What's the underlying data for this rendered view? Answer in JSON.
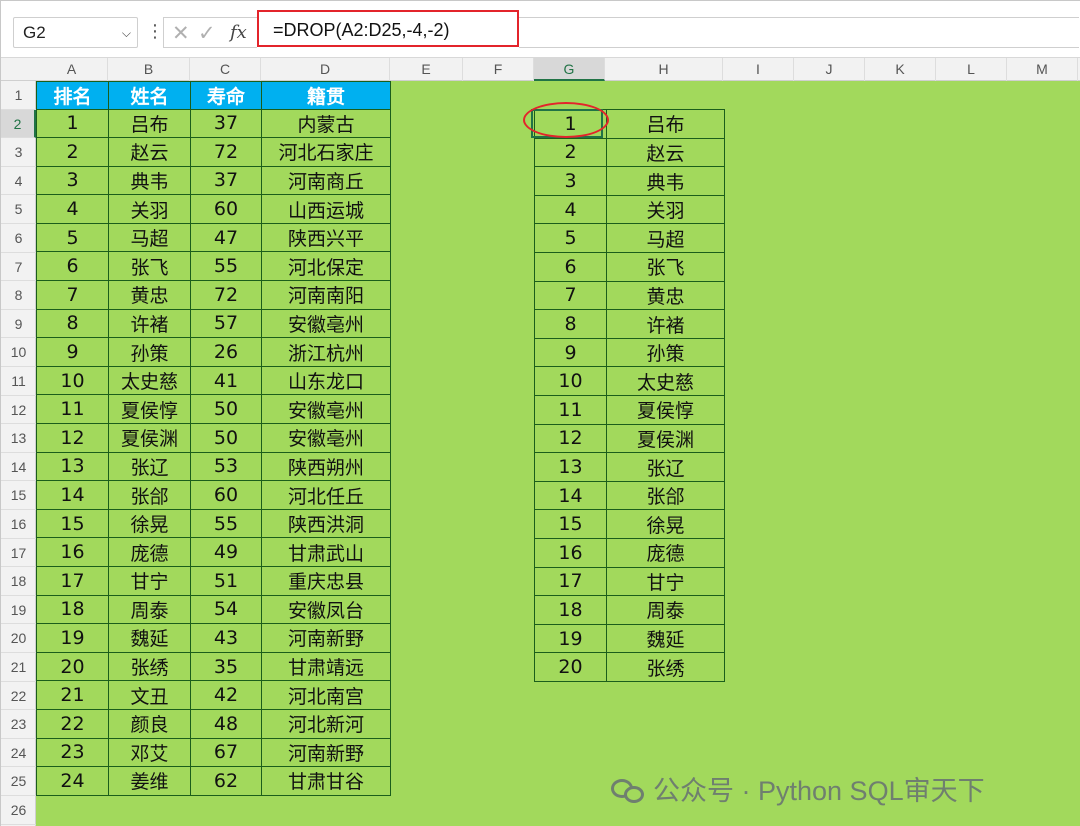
{
  "name_box": "G2",
  "formula": "=DROP(A2:D25,-4,-2)",
  "fx_label": "fx",
  "columns": [
    "A",
    "B",
    "C",
    "D",
    "E",
    "F",
    "G",
    "H",
    "I",
    "J",
    "K",
    "L",
    "M"
  ],
  "rows": [
    "1",
    "2",
    "3",
    "4",
    "5",
    "6",
    "7",
    "8",
    "9",
    "10",
    "11",
    "12",
    "13",
    "14",
    "15",
    "16",
    "17",
    "18",
    "19",
    "20",
    "21",
    "22",
    "23",
    "24",
    "25",
    "26"
  ],
  "source_table": {
    "headers": [
      "排名",
      "姓名",
      "寿命",
      "籍贯"
    ],
    "rows": [
      [
        "1",
        "吕布",
        "37",
        "内蒙古"
      ],
      [
        "2",
        "赵云",
        "72",
        "河北石家庄"
      ],
      [
        "3",
        "典韦",
        "37",
        "河南商丘"
      ],
      [
        "4",
        "关羽",
        "60",
        "山西运城"
      ],
      [
        "5",
        "马超",
        "47",
        "陕西兴平"
      ],
      [
        "6",
        "张飞",
        "55",
        "河北保定"
      ],
      [
        "7",
        "黄忠",
        "72",
        "河南南阳"
      ],
      [
        "8",
        "许褚",
        "57",
        "安徽亳州"
      ],
      [
        "9",
        "孙策",
        "26",
        "浙江杭州"
      ],
      [
        "10",
        "太史慈",
        "41",
        "山东龙口"
      ],
      [
        "11",
        "夏侯惇",
        "50",
        "安徽亳州"
      ],
      [
        "12",
        "夏侯渊",
        "50",
        "安徽亳州"
      ],
      [
        "13",
        "张辽",
        "53",
        "陕西朔州"
      ],
      [
        "14",
        "张郃",
        "60",
        "河北任丘"
      ],
      [
        "15",
        "徐晃",
        "55",
        "陕西洪洞"
      ],
      [
        "16",
        "庞德",
        "49",
        "甘肃武山"
      ],
      [
        "17",
        "甘宁",
        "51",
        "重庆忠县"
      ],
      [
        "18",
        "周泰",
        "54",
        "安徽凤台"
      ],
      [
        "19",
        "魏延",
        "43",
        "河南新野"
      ],
      [
        "20",
        "张绣",
        "35",
        "甘肃靖远"
      ],
      [
        "21",
        "文丑",
        "42",
        "河北南宫"
      ],
      [
        "22",
        "颜良",
        "48",
        "河北新河"
      ],
      [
        "23",
        "邓艾",
        "67",
        "河南新野"
      ],
      [
        "24",
        "姜维",
        "62",
        "甘肃甘谷"
      ]
    ]
  },
  "result_table": {
    "rows": [
      [
        "1",
        "吕布"
      ],
      [
        "2",
        "赵云"
      ],
      [
        "3",
        "典韦"
      ],
      [
        "4",
        "关羽"
      ],
      [
        "5",
        "马超"
      ],
      [
        "6",
        "张飞"
      ],
      [
        "7",
        "黄忠"
      ],
      [
        "8",
        "许褚"
      ],
      [
        "9",
        "孙策"
      ],
      [
        "10",
        "太史慈"
      ],
      [
        "11",
        "夏侯惇"
      ],
      [
        "12",
        "夏侯渊"
      ],
      [
        "13",
        "张辽"
      ],
      [
        "14",
        "张郃"
      ],
      [
        "15",
        "徐晃"
      ],
      [
        "16",
        "庞德"
      ],
      [
        "17",
        "甘宁"
      ],
      [
        "18",
        "周泰"
      ],
      [
        "19",
        "魏延"
      ],
      [
        "20",
        "张绣"
      ]
    ]
  },
  "watermark": "公众号 · Python SQL审天下",
  "colors": {
    "sheet_bg": "#a2d95c",
    "header_fill": "#00b0f0",
    "highlight": "#e3242b",
    "selection": "#217346"
  }
}
